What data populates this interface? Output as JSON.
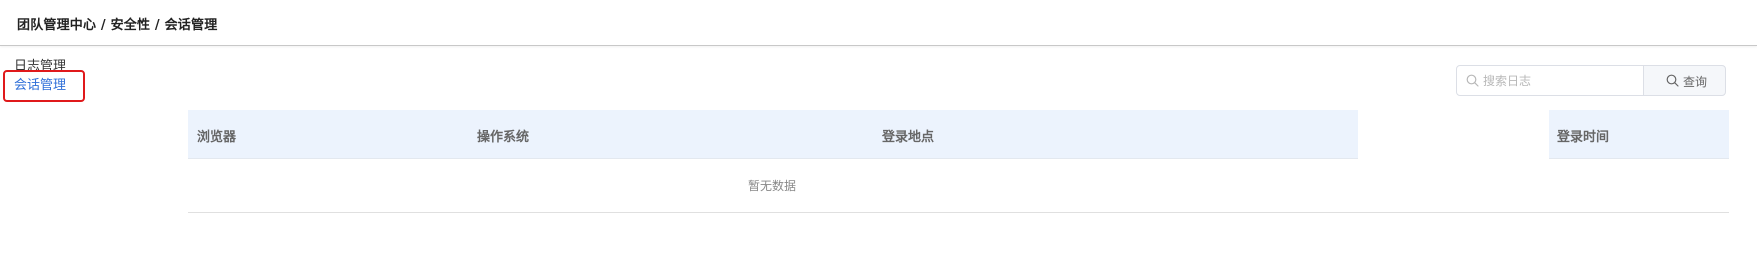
{
  "header": {
    "breadcrumb": "团队管理中心 / 安全性 / 会话管理"
  },
  "sidebar": {
    "items": [
      {
        "label": "日志管理",
        "selected": false
      },
      {
        "label": "会话管理",
        "selected": true
      }
    ]
  },
  "search": {
    "placeholder": "搜索日志",
    "value": "",
    "button_label": "查询",
    "icon": "search-icon"
  },
  "table": {
    "columns": [
      "浏览器",
      "操作系统",
      "登录地点",
      "登录时间"
    ],
    "rows": [],
    "empty_text": "暂无数据"
  },
  "colors": {
    "accent": "#2f6fd8",
    "highlight_border": "#e0191b",
    "table_header_bg": "#ecf3fd"
  }
}
